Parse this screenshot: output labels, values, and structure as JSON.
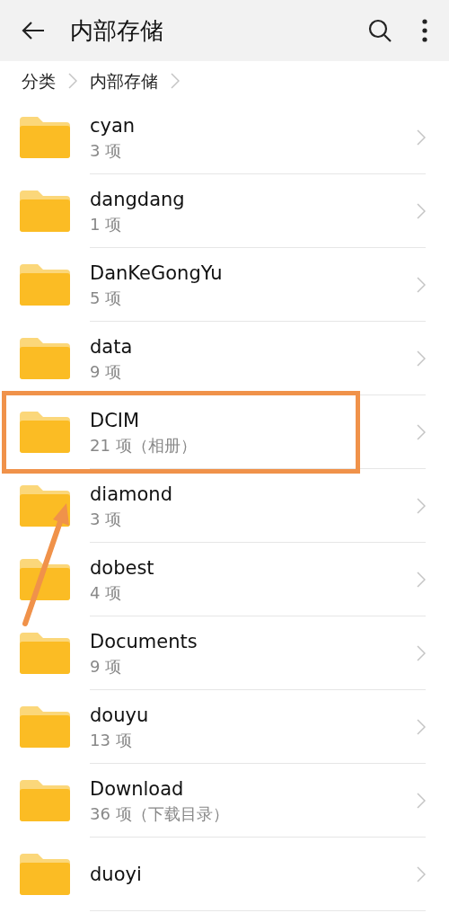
{
  "header": {
    "title": "内部存储"
  },
  "breadcrumb": [
    "分类",
    "内部存储"
  ],
  "folders": [
    {
      "name": "cyan",
      "count": "3 项",
      "highlighted": false
    },
    {
      "name": "dangdang",
      "count": "1 项",
      "highlighted": false
    },
    {
      "name": "DanKeGongYu",
      "count": "5 项",
      "highlighted": false
    },
    {
      "name": "data",
      "count": "9 项",
      "highlighted": false
    },
    {
      "name": "DCIM",
      "count": "21 项（相册）",
      "highlighted": true
    },
    {
      "name": "diamond",
      "count": "3 项",
      "highlighted": false
    },
    {
      "name": "dobest",
      "count": "4 项",
      "highlighted": false
    },
    {
      "name": "Documents",
      "count": "9 项",
      "highlighted": false
    },
    {
      "name": "douyu",
      "count": "13 项",
      "highlighted": false
    },
    {
      "name": "Download",
      "count": "36 项（下载目录）",
      "highlighted": false
    },
    {
      "name": "duoyi",
      "highlighted": false
    }
  ]
}
